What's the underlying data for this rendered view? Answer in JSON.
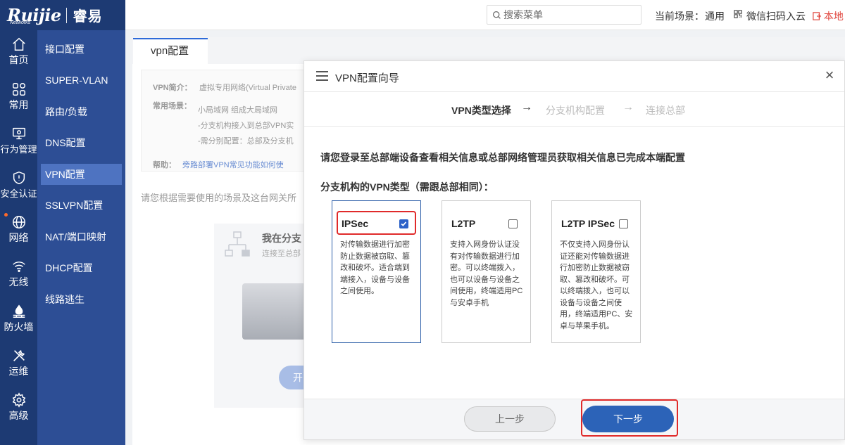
{
  "brand": {
    "logo": "Ruijie",
    "logo_sub": "Networks",
    "product": "睿易"
  },
  "rail": [
    {
      "label": "首页",
      "icon": "home-icon"
    },
    {
      "label": "常用",
      "icon": "grid-icon"
    },
    {
      "label": "行为管理",
      "icon": "monitor-icon"
    },
    {
      "label": "安全认证",
      "icon": "shield-icon"
    },
    {
      "label": "网络",
      "icon": "globe-icon"
    },
    {
      "label": "无线",
      "icon": "wifi-icon"
    },
    {
      "label": "防火墙",
      "icon": "firewall-icon"
    },
    {
      "label": "运维",
      "icon": "tools-icon"
    },
    {
      "label": "高级",
      "icon": "gear-icon"
    }
  ],
  "subnav": [
    "接口配置",
    "SUPER-VLAN",
    "路由/负载",
    "DNS配置",
    "VPN配置",
    "SSLVPN配置",
    "NAT/端口映射",
    "DHCP配置",
    "线路逃生"
  ],
  "header": {
    "search_placeholder": "搜索菜单",
    "scene_label": "当前场景：",
    "scene_value": "通用",
    "wechat": "微信扫码入云",
    "local": "本地"
  },
  "page": {
    "tab": "vpn配置",
    "intro_label1": "VPN简介：",
    "intro_val1": "虚拟专用网络(Virtual Private",
    "intro_label2": "常用场景：",
    "intro_val2a": "小局域网 组成大局域网",
    "intro_val2b": "-分支机构接入到总部VPN实",
    "intro_val2c": "-需分别配置：总部及分支机",
    "intro_label3": "帮助：",
    "intro_val3": "旁路部署VPN常见功能如何使",
    "hint": "请您根据需要使用的场景及这台网关所",
    "panel_title": "我在分支",
    "panel_sub": "连接至总部",
    "panel_btn": "开"
  },
  "modal": {
    "title": "VPN配置向导",
    "close": "×",
    "steps": [
      "VPN类型选择",
      "分支机构配置",
      "连接总部"
    ],
    "arrow": "→",
    "info": "请您登录至总部端设备查看相关信息或总部网络管理员获取相关信息已完成本端配置",
    "type_label": "分支机构的VPN类型（需跟总部相同）：",
    "options": [
      {
        "name": "IPSec",
        "checked": true,
        "desc": "对传输数据进行加密防止数据被窃取、篡改和破坏。适合端到端接入，设备与设备之间使用。"
      },
      {
        "name": "L2TP",
        "checked": false,
        "desc": "支持入网身份认证没有对传输数据进行加密。可以终端拨入，也可以设备与设备之间使用，终端适用PC与安卓手机"
      },
      {
        "name": "L2TP IPSec",
        "checked": false,
        "desc": "不仅支持入网身份认证还能对传输数据进行加密防止数据被窃取、篡改和破坏。可以终端拨入，也可以设备与设备之间使用，终端适用PC、安卓与苹果手机。"
      }
    ],
    "prev": "上一步",
    "next": "下一步"
  },
  "colors": {
    "rail": "#1d3a73",
    "subnav": "#2d4e95",
    "accent": "#2c63b8",
    "highlight": "#e02a2a"
  }
}
